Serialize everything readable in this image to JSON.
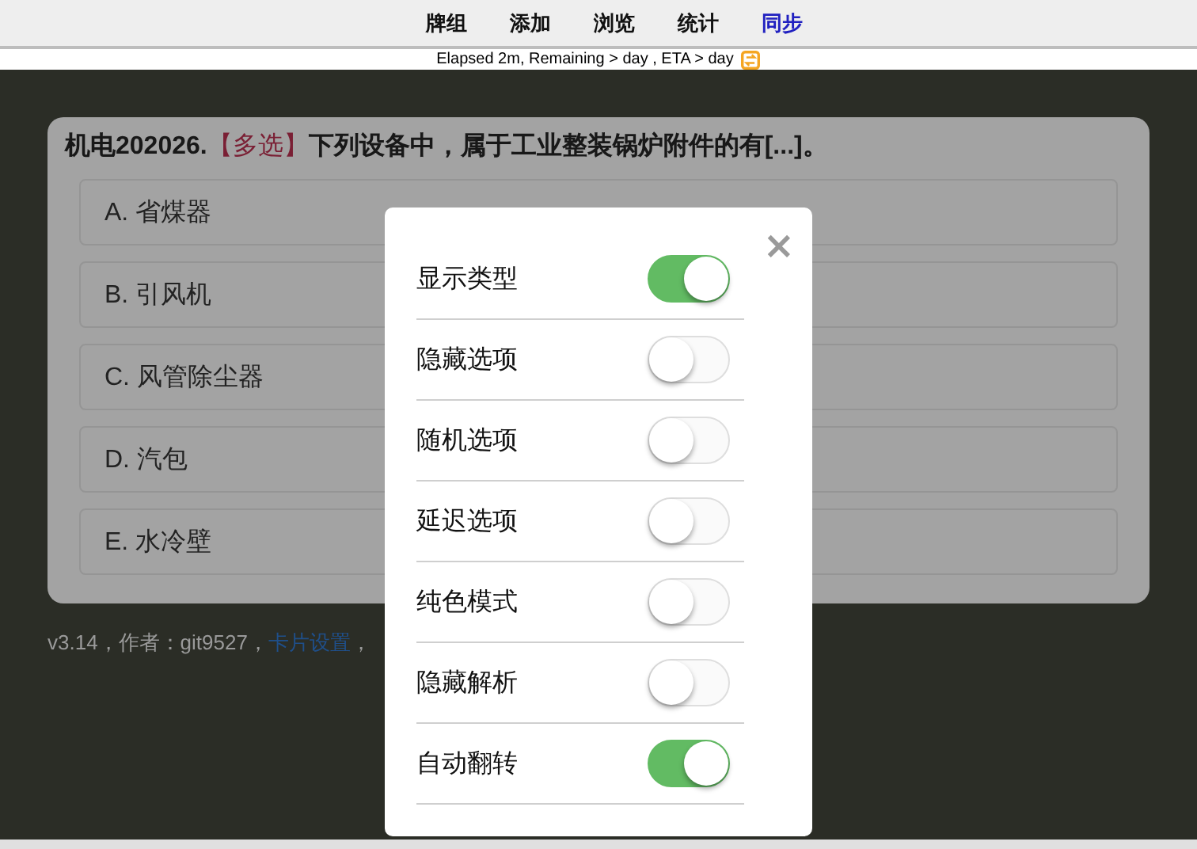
{
  "nav": [
    {
      "label": "牌组",
      "selected": false
    },
    {
      "label": "添加",
      "selected": false
    },
    {
      "label": "浏览",
      "selected": false
    },
    {
      "label": "统计",
      "selected": false
    },
    {
      "label": "同步",
      "selected": true
    }
  ],
  "status_line": "Elapsed 2m, Remaining > day , ETA > day",
  "question": {
    "number": "机电202026.",
    "type_tag": "【多选】",
    "stem": "下列设备中，属于工业整装锅炉附件的有[...]。",
    "options": [
      "A. 省煤器",
      "B. 引风机",
      "C. 风管除尘器",
      "D. 汽包",
      "E. 水冷壁"
    ]
  },
  "footer": {
    "text": "v3.14，作者：git9527，",
    "link": "卡片设置",
    "tail": "，"
  },
  "settings_dialog": {
    "close": "×",
    "settings": [
      {
        "label": "显示类型",
        "on": true
      },
      {
        "label": "隐藏选项",
        "on": false
      },
      {
        "label": "随机选项",
        "on": false
      },
      {
        "label": "延迟选项",
        "on": false
      },
      {
        "label": "纯色模式",
        "on": false
      },
      {
        "label": "隐藏解析",
        "on": false
      },
      {
        "label": "自动翻转",
        "on": true
      }
    ]
  }
}
